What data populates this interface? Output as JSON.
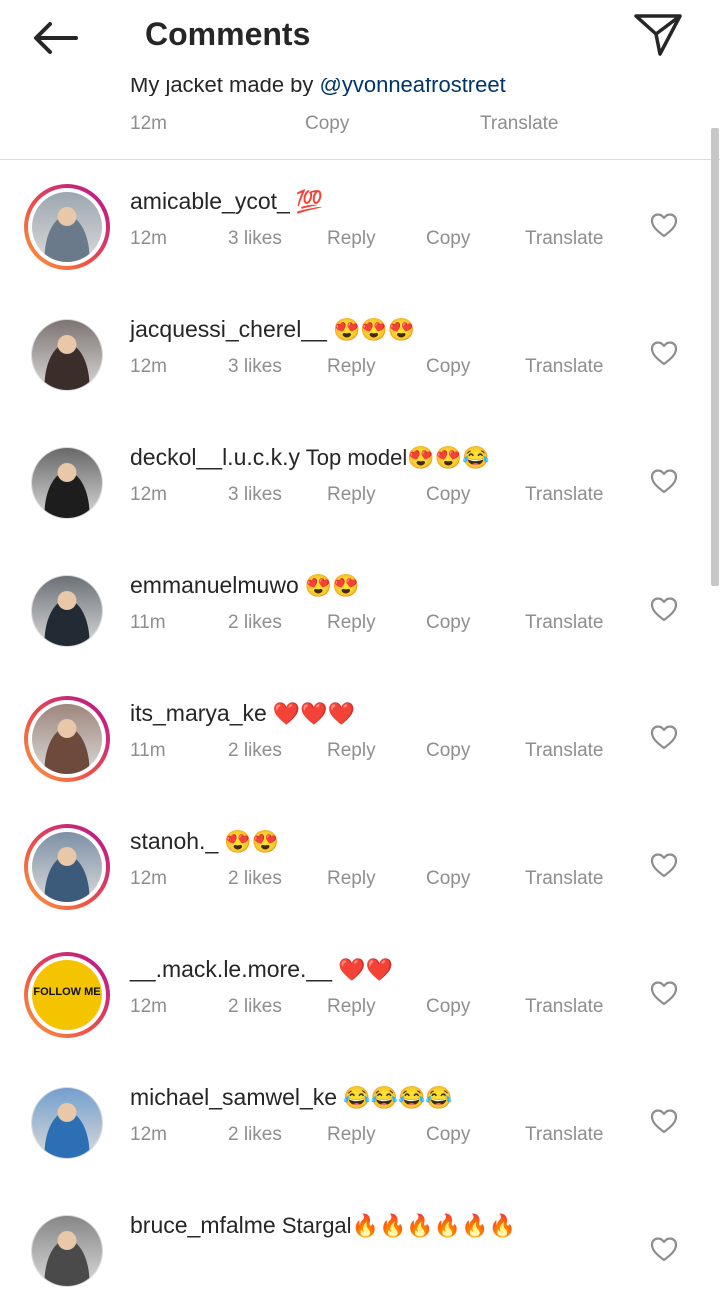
{
  "header": {
    "title": "Comments"
  },
  "caption": {
    "text": "My jacket made by ",
    "tag": "@yvonneafrostreet",
    "time": "12m",
    "copy": "Copy",
    "translate": "Translate"
  },
  "labels": {
    "reply": "Reply",
    "copy": "Copy",
    "translate": "Translate"
  },
  "comments": [
    {
      "username": "amicable_ycot_",
      "text": "💯",
      "time": "12m",
      "likes": "3 likes",
      "ring": true,
      "avatar_color": "#6b7a8a"
    },
    {
      "username": "jacquessi_cherel__",
      "text": "😍😍😍",
      "time": "12m",
      "likes": "3 likes",
      "ring": false,
      "avatar_color": "#3b2e2a"
    },
    {
      "username": "deckol__l.u.c.k.y",
      "text": " Top model😍😍😂",
      "time": "12m",
      "likes": "3 likes",
      "ring": false,
      "avatar_color": "#1d1d1d"
    },
    {
      "username": "emmanuelmuwo",
      "text": "😍😍",
      "time": "11m",
      "likes": "2 likes",
      "ring": false,
      "avatar_color": "#222a33"
    },
    {
      "username": "its_marya_ke",
      "text": "❤️❤️❤️",
      "time": "11m",
      "likes": "2 likes",
      "ring": true,
      "avatar_color": "#6d4a3c"
    },
    {
      "username": "stanoh._",
      "text": "😍😍",
      "time": "12m",
      "likes": "2 likes",
      "ring": true,
      "avatar_color": "#3c5a7a"
    },
    {
      "username": "__.mack.le.more.__",
      "text": "❤️❤️",
      "time": "12m",
      "likes": "2 likes",
      "ring": true,
      "avatar_color": "#f5c400",
      "avatar_text": "FOLLOW ME"
    },
    {
      "username": "michael_samwel_ke",
      "text": "😂😂😂😂",
      "time": "12m",
      "likes": "2 likes",
      "ring": false,
      "avatar_color": "#2c6fb5"
    },
    {
      "username": "bruce_mfalme",
      "text": " Stargal🔥🔥🔥🔥🔥🔥",
      "time": "",
      "likes": "",
      "ring": false,
      "avatar_color": "#4a4a4a"
    }
  ]
}
